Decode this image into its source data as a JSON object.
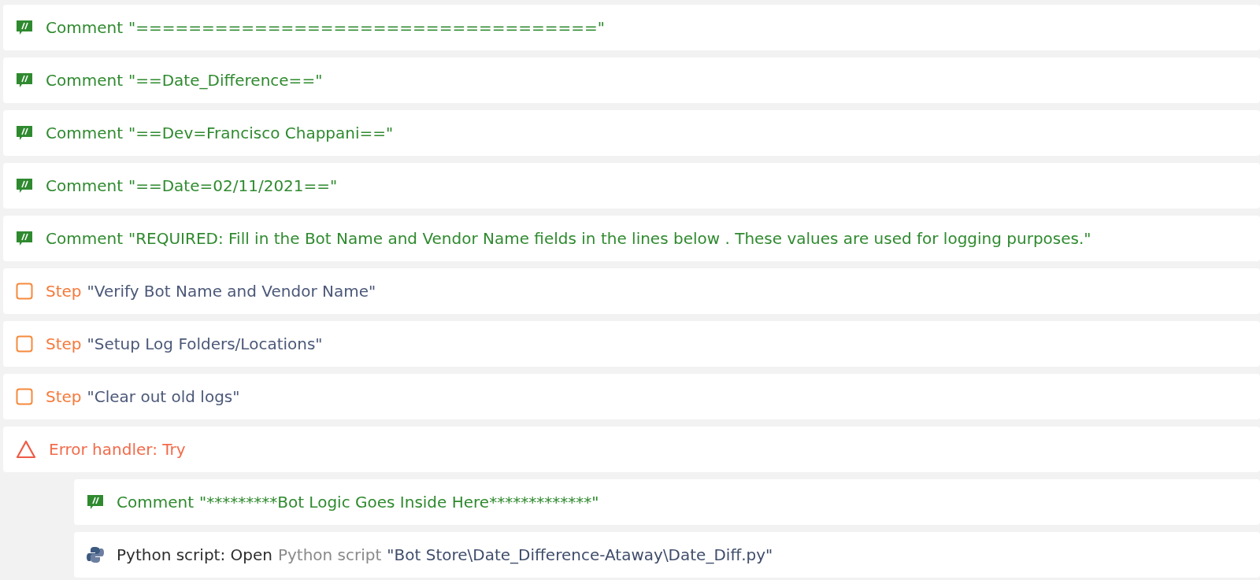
{
  "actions": [
    {
      "kind": "comment",
      "label": "Comment",
      "text": "\"===================================\""
    },
    {
      "kind": "comment",
      "label": "Comment",
      "text": "\"==Date_Difference==\""
    },
    {
      "kind": "comment",
      "label": "Comment",
      "text": "\"==Dev=Francisco Chappani==\""
    },
    {
      "kind": "comment",
      "label": "Comment",
      "text": "\"==Date=02/11/2021==\""
    },
    {
      "kind": "comment",
      "label": "Comment",
      "text": "\"REQUIRED: Fill in the Bot Name and Vendor Name fields in the lines below . These values are used for logging purposes.\""
    },
    {
      "kind": "step",
      "label": "Step",
      "text": "\"Verify Bot Name and Vendor Name\""
    },
    {
      "kind": "step",
      "label": "Step",
      "text": "\"Setup Log Folders/Locations\""
    },
    {
      "kind": "step",
      "label": "Step",
      "text": "\"Clear out old logs\""
    },
    {
      "kind": "error",
      "label": "Error handler: Try",
      "children": [
        {
          "kind": "comment",
          "label": "Comment",
          "text": "\"*********Bot Logic Goes Inside Here*************\""
        },
        {
          "kind": "python",
          "label": "Python script: Open",
          "detail": "Python script",
          "text": "\"Bot Store\\Date_Difference-Ataway\\Date_Diff.py\""
        }
      ]
    }
  ]
}
